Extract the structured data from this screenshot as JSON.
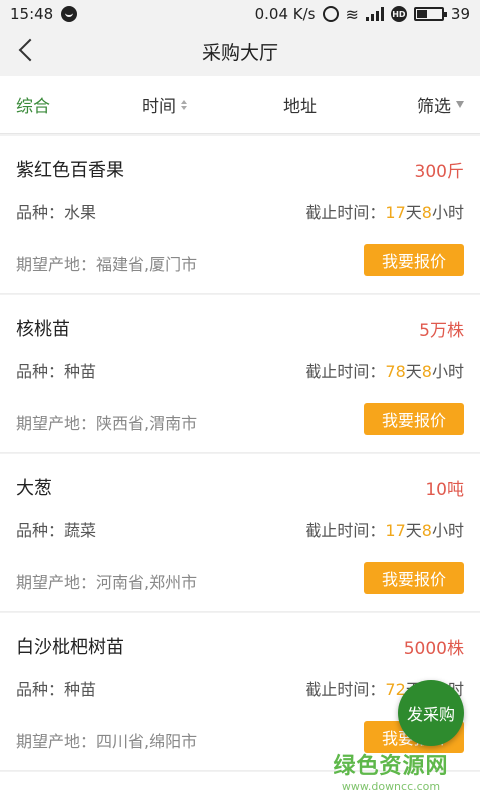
{
  "status_bar": {
    "time": "15:48",
    "speed": "0.04 K/s",
    "network": "4G",
    "battery": "39"
  },
  "nav": {
    "title": "采购大厅"
  },
  "filters": {
    "tabs": [
      {
        "label": "综合",
        "active": true
      },
      {
        "label": "时间"
      },
      {
        "label": "地址"
      },
      {
        "label": "筛选"
      }
    ]
  },
  "colors": {
    "accent_green": "#3a8a3a",
    "quantity_red": "#e05a4e",
    "button_orange": "#f7a51b",
    "deadline_orange": "#f0a71b"
  },
  "list": {
    "cat_label": "品种：",
    "deadline_label": "截止时间：",
    "origin_label": "期望产地：",
    "day_unit": "天",
    "hour_unit": "小时",
    "quote_label": "我要报价",
    "items": [
      {
        "name": "紫红色百香果",
        "qty": "300斤",
        "category": "水果",
        "days": "17",
        "hours": "8",
        "origin": "福建省,厦门市"
      },
      {
        "name": "核桃苗",
        "qty": "5万株",
        "category": "种苗",
        "days": "78",
        "hours": "8",
        "origin": "陕西省,渭南市"
      },
      {
        "name": "大葱",
        "qty": "10吨",
        "category": "蔬菜",
        "days": "17",
        "hours": "8",
        "origin": "河南省,郑州市"
      },
      {
        "name": "白沙枇杷树苗",
        "qty": "5000株",
        "category": "种苗",
        "days": "72",
        "hours": "8",
        "origin": "四川省,绵阳市"
      }
    ]
  },
  "fab": {
    "label": "发采购"
  },
  "watermark": {
    "main": "绿色资源网",
    "sub": "www.downcc.com"
  }
}
